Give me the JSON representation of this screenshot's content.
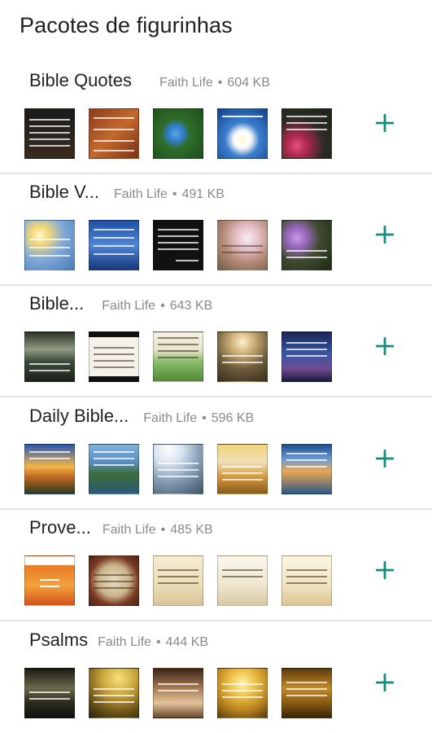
{
  "screen": {
    "title": "Pacotes de figurinhas"
  },
  "colors": {
    "accent": "#128c7e",
    "meta_text": "#8a8a8a",
    "divider": "#e3e3e3"
  },
  "packs": [
    {
      "name": "Bible Quotes",
      "publisher": "Faith Life",
      "separator": "•",
      "size": "604 KB",
      "add_icon": "plus-icon",
      "thumbnails": [
        {
          "style": "dark-black-text"
        },
        {
          "style": "brown-cyrillic-text"
        },
        {
          "style": "blue-flower"
        },
        {
          "style": "white-daisy-blue-sky"
        },
        {
          "style": "pink-flowers-dark"
        }
      ]
    },
    {
      "name": "Bible V...",
      "publisher": "Faith Life",
      "separator": "•",
      "size": "491 KB",
      "add_icon": "plus-icon",
      "thumbnails": [
        {
          "style": "sunny-sky"
        },
        {
          "style": "blue-sky-text"
        },
        {
          "style": "black-text-card"
        },
        {
          "style": "white-blossoms"
        },
        {
          "style": "purple-flower"
        }
      ]
    },
    {
      "name": "Bible...",
      "publisher": "Faith Life",
      "separator": "•",
      "size": "643 KB",
      "add_icon": "plus-icon",
      "thumbnails": [
        {
          "style": "dark-sunrise-sea"
        },
        {
          "style": "white-card-black-border"
        },
        {
          "style": "green-field-text"
        },
        {
          "style": "sunlit-forest"
        },
        {
          "style": "night-sky-text"
        }
      ]
    },
    {
      "name": "Daily Bible...",
      "publisher": "Faith Life",
      "separator": "•",
      "size": "596 KB",
      "add_icon": "plus-icon",
      "thumbnails": [
        {
          "style": "sunset-mountains"
        },
        {
          "style": "mountain-lake"
        },
        {
          "style": "light-rays-path"
        },
        {
          "style": "golden-clouds"
        },
        {
          "style": "blue-mountain-sunset"
        }
      ]
    },
    {
      "name": "Prove...",
      "publisher": "Faith Life",
      "separator": "•",
      "size": "485 KB",
      "add_icon": "plus-icon",
      "thumbnails": [
        {
          "style": "cartoon-house"
        },
        {
          "style": "framed-parchment"
        },
        {
          "style": "parchment-card"
        },
        {
          "style": "parchment-tree"
        },
        {
          "style": "parchment-branch"
        }
      ]
    },
    {
      "name": "Psalms",
      "publisher": "Faith Life",
      "separator": "•",
      "size": "444 KB",
      "add_icon": "plus-icon",
      "thumbnails": [
        {
          "style": "dark-horizon"
        },
        {
          "style": "golden-bird"
        },
        {
          "style": "praying-hands"
        },
        {
          "style": "golden-sunrise"
        },
        {
          "style": "amber-text"
        }
      ]
    }
  ]
}
